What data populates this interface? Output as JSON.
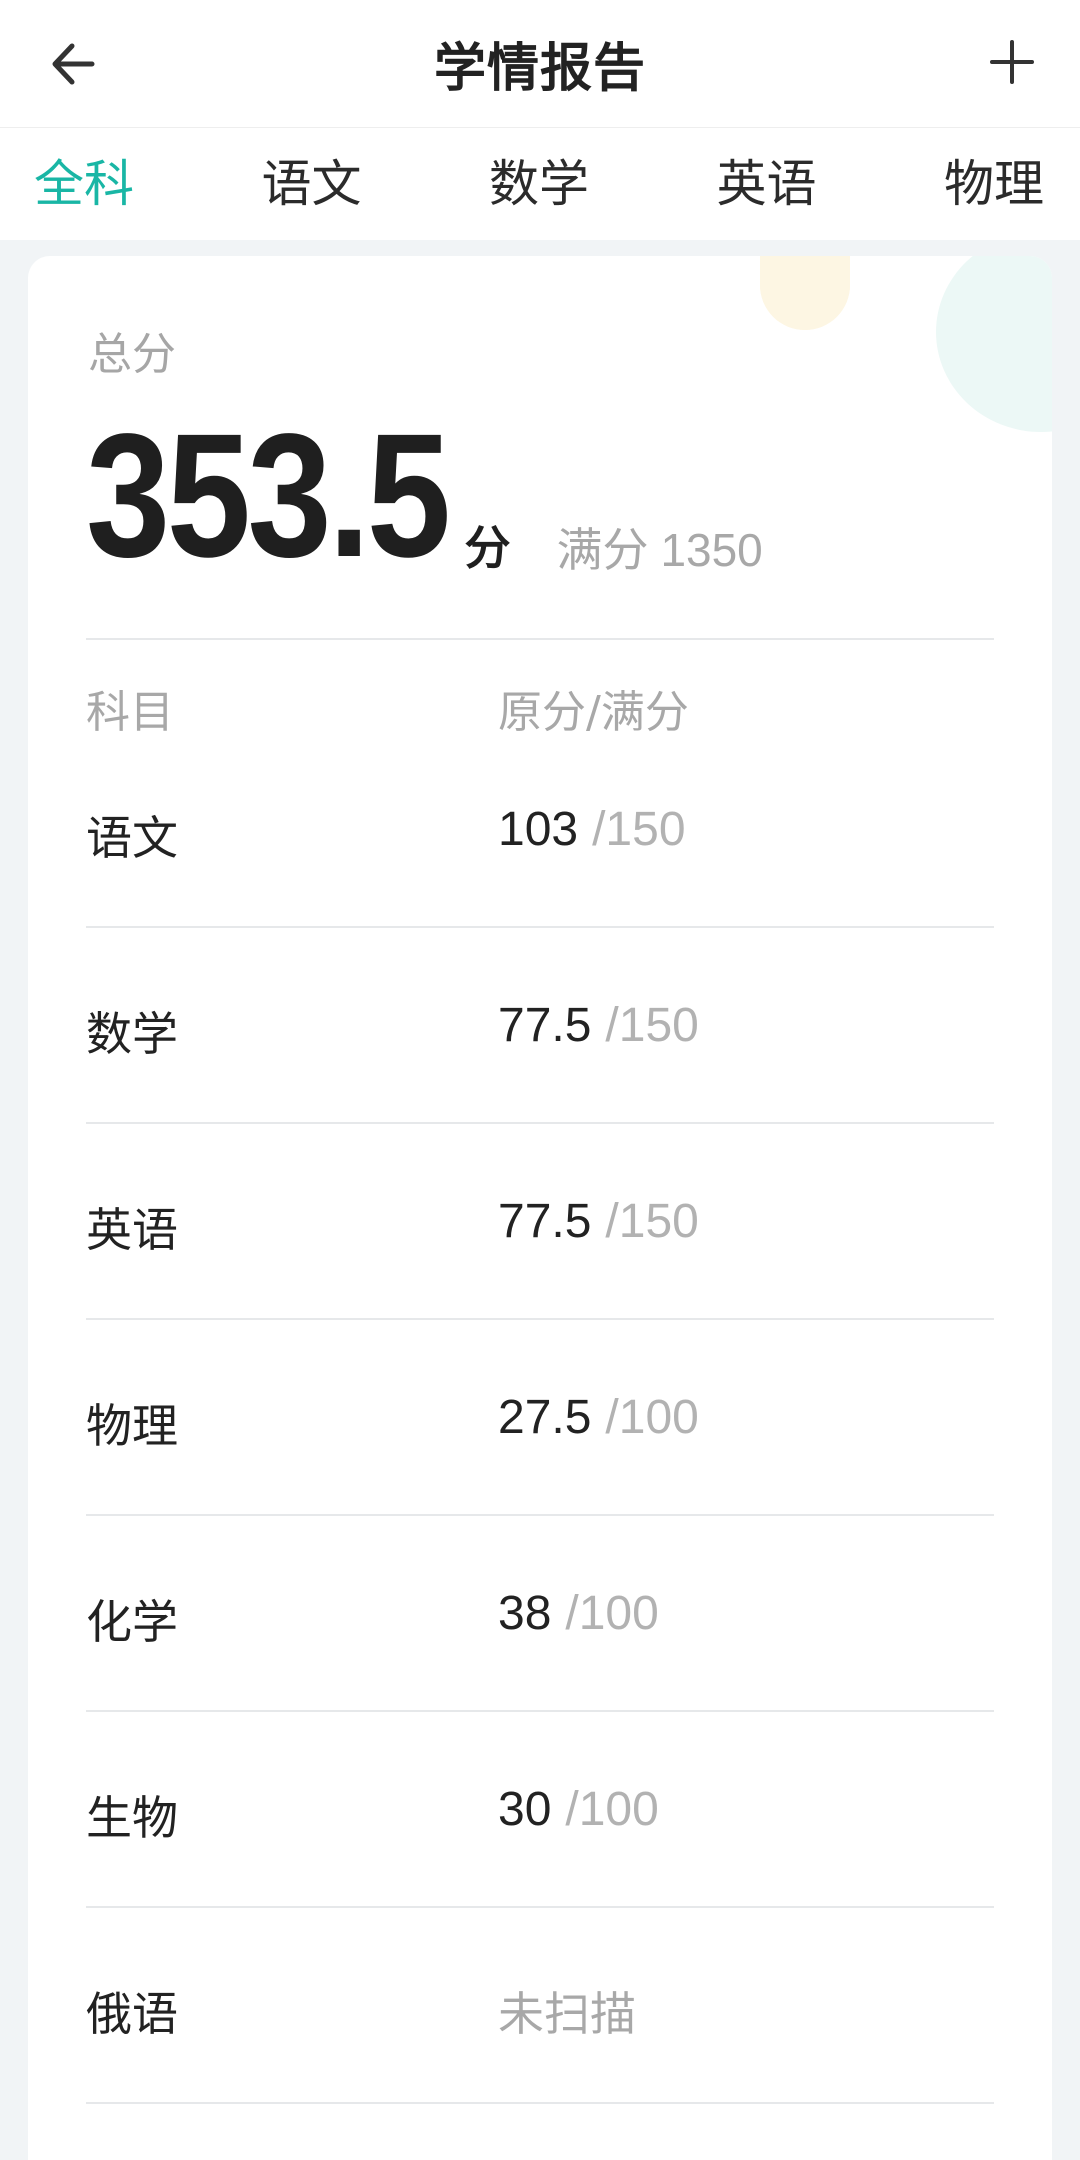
{
  "navbar": {
    "title": "学情报告",
    "back_icon": "arrow-left-icon",
    "add_icon": "plus-icon"
  },
  "tabs": [
    {
      "label": "全科",
      "active": true
    },
    {
      "label": "语文",
      "active": false
    },
    {
      "label": "数学",
      "active": false
    },
    {
      "label": "英语",
      "active": false
    },
    {
      "label": "物理",
      "active": false
    }
  ],
  "summary": {
    "total_label": "总分",
    "total_value": "353.5",
    "total_unit": "分",
    "full_label": "满分",
    "full_value": "1350"
  },
  "table": {
    "header_subject": "科目",
    "header_score": "原分/满分",
    "rows": [
      {
        "subject": "语文",
        "score": "103",
        "full": "/150"
      },
      {
        "subject": "数学",
        "score": "77.5",
        "full": "/150"
      },
      {
        "subject": "英语",
        "score": "77.5",
        "full": "/150"
      },
      {
        "subject": "物理",
        "score": "27.5",
        "full": "/100"
      },
      {
        "subject": "化学",
        "score": "38",
        "full": "/100"
      },
      {
        "subject": "生物",
        "score": "30",
        "full": "/100"
      },
      {
        "subject": "俄语",
        "status": "未扫描"
      }
    ]
  },
  "colors": {
    "accent": "#19b6a5",
    "text": "#222222",
    "muted": "#a8a8a8",
    "background": "#f1f4f6"
  }
}
